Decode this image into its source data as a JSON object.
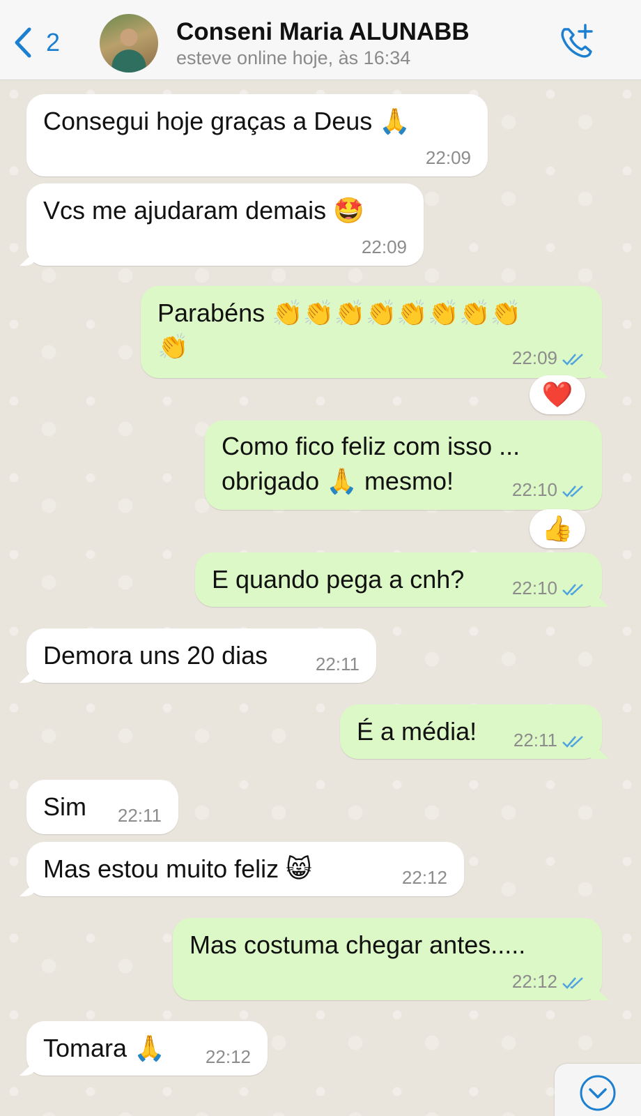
{
  "header": {
    "back_count": "2",
    "contact_name": "Conseni Maria ALUNABB",
    "status": "esteve online hoje, às 16:34"
  },
  "messages": [
    {
      "dir": "in",
      "text": "Consegui hoje graças a Deus 🙏",
      "time": "22:09"
    },
    {
      "dir": "in",
      "text": "Vcs me ajudaram demais 🤩",
      "time": "22:09"
    },
    {
      "dir": "out",
      "line1": "Parabéns 👏👏👏👏👏👏👏👏",
      "line2": "👏",
      "time": "22:09",
      "reaction": "❤️"
    },
    {
      "dir": "out",
      "line1": "Como fico feliz com isso ...",
      "line2": "obrigado 🙏 mesmo!",
      "time": "22:10",
      "reaction": "👍"
    },
    {
      "dir": "out",
      "text": "E quando pega a cnh?",
      "time": "22:10"
    },
    {
      "dir": "in",
      "text": "Demora uns 20 dias",
      "time": "22:11"
    },
    {
      "dir": "out",
      "text": "É a média!",
      "time": "22:11"
    },
    {
      "dir": "in",
      "text": "Sim",
      "time": "22:11"
    },
    {
      "dir": "in",
      "text": "Mas estou muito feliz 😸",
      "time": "22:12"
    },
    {
      "dir": "out",
      "text": "Mas costuma chegar antes.....",
      "time": "22:12"
    },
    {
      "dir": "in",
      "text": "Tomara 🙏",
      "time": "22:12"
    }
  ],
  "colors": {
    "incoming": "#ffffff",
    "outgoing": "#dcf8c6",
    "accent": "#1d7fd0",
    "read_ticks": "#4fa3e0"
  },
  "icons": {
    "back": "chevron-left-icon",
    "call": "add-call-icon",
    "read": "double-check-icon",
    "scroll": "chevron-down-circle-icon"
  }
}
